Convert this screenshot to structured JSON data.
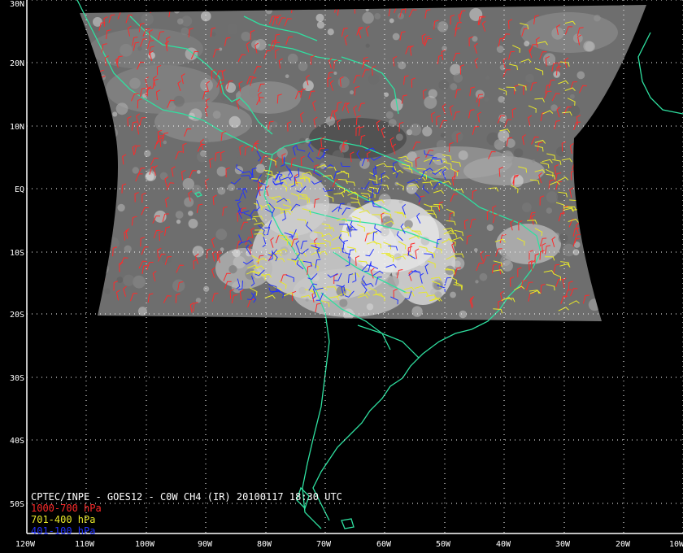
{
  "caption": "CPTEC/INPE - GOES12 - C0W CH4 (IR) 20100117 18:30 UTC",
  "legend": [
    {
      "label": "1000-700 hPa",
      "color": "#ff2a2a"
    },
    {
      "label": "701-400 hPa",
      "color": "#e8e82a"
    },
    {
      "label": "401-100 hPa",
      "color": "#2233ff"
    }
  ],
  "lat_labels": [
    "30N",
    "20N",
    "10N",
    "EQ",
    "10S",
    "20S",
    "30S",
    "40S",
    "50S"
  ],
  "lon_labels": [
    "120W",
    "110W",
    "100W",
    "90W",
    "80W",
    "70W",
    "60W",
    "50W",
    "40W",
    "30W",
    "20W",
    "10W"
  ],
  "colors": {
    "background": "#000000",
    "grid": "#ffffff",
    "coastline": "#2fe0a0",
    "ir_base": "#6e6e6e"
  }
}
